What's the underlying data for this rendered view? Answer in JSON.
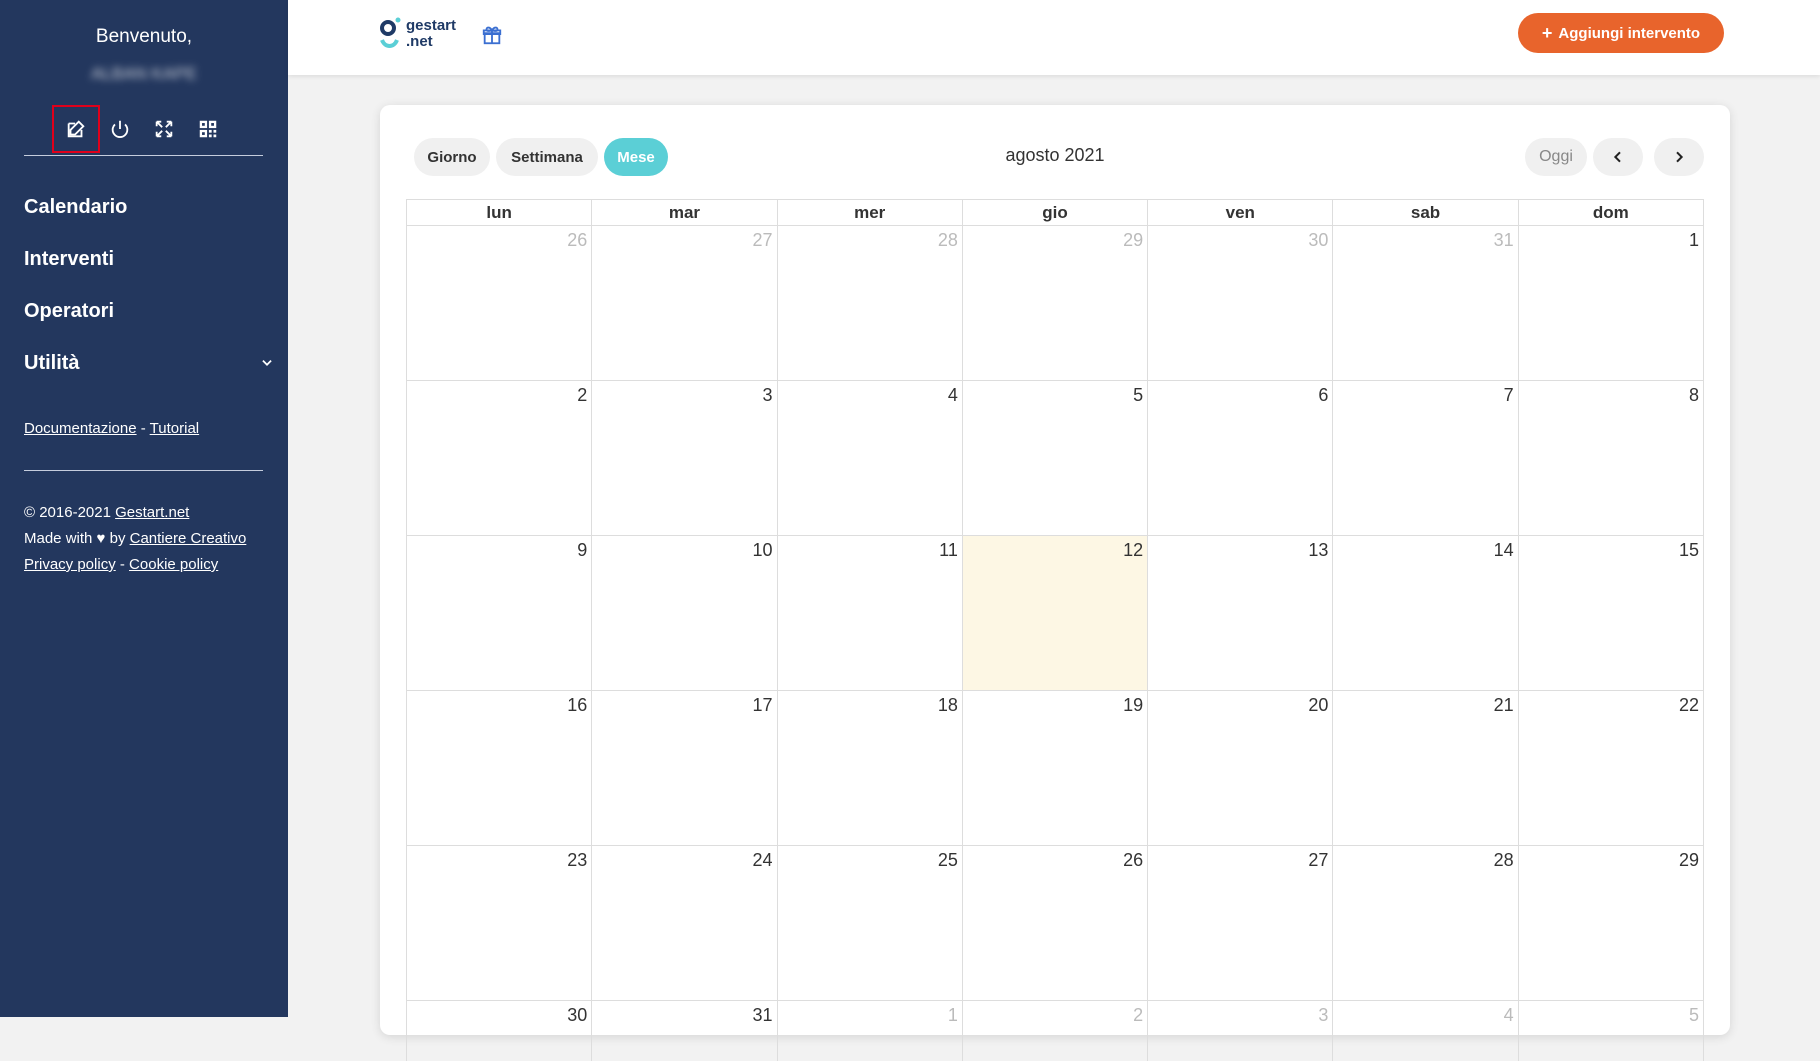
{
  "sidebar": {
    "welcome": "Benvenuto,",
    "username": "ALBAN KAPE",
    "nav": [
      {
        "label": "Calendario"
      },
      {
        "label": "Interventi"
      },
      {
        "label": "Operatori"
      },
      {
        "label": "Utilità"
      }
    ],
    "links": {
      "doc": "Documentazione",
      "sep": "-",
      "tutorial": "Tutorial"
    },
    "footer": {
      "copyright": "© 2016-2021",
      "company_link": "Gestart.net",
      "made_with": "Made with ♥ by",
      "creator_link": "Cantiere Creativo",
      "privacy": "Privacy policy",
      "sep": "-",
      "cookie": "Cookie policy"
    }
  },
  "topbar": {
    "logo_line1": "gestart",
    "logo_line2": ".net",
    "add_button": "Aggiungi intervento"
  },
  "calendar": {
    "views": {
      "day": "Giorno",
      "week": "Settimana",
      "month": "Mese"
    },
    "title": "agosto 2021",
    "today_button": "Oggi",
    "weekdays": [
      "lun",
      "mar",
      "mer",
      "gio",
      "ven",
      "sab",
      "dom"
    ],
    "weeks": [
      [
        {
          "d": "26",
          "other": true
        },
        {
          "d": "27",
          "other": true
        },
        {
          "d": "28",
          "other": true
        },
        {
          "d": "29",
          "other": true
        },
        {
          "d": "30",
          "other": true
        },
        {
          "d": "31",
          "other": true
        },
        {
          "d": "1"
        }
      ],
      [
        {
          "d": "2"
        },
        {
          "d": "3"
        },
        {
          "d": "4"
        },
        {
          "d": "5"
        },
        {
          "d": "6"
        },
        {
          "d": "7"
        },
        {
          "d": "8"
        }
      ],
      [
        {
          "d": "9"
        },
        {
          "d": "10"
        },
        {
          "d": "11"
        },
        {
          "d": "12",
          "today": true
        },
        {
          "d": "13"
        },
        {
          "d": "14"
        },
        {
          "d": "15"
        }
      ],
      [
        {
          "d": "16"
        },
        {
          "d": "17"
        },
        {
          "d": "18"
        },
        {
          "d": "19"
        },
        {
          "d": "20"
        },
        {
          "d": "21"
        },
        {
          "d": "22"
        }
      ],
      [
        {
          "d": "23"
        },
        {
          "d": "24"
        },
        {
          "d": "25"
        },
        {
          "d": "26"
        },
        {
          "d": "27"
        },
        {
          "d": "28"
        },
        {
          "d": "29"
        }
      ],
      [
        {
          "d": "30"
        },
        {
          "d": "31"
        },
        {
          "d": "1",
          "other": true
        },
        {
          "d": "2",
          "other": true
        },
        {
          "d": "3",
          "other": true
        },
        {
          "d": "4",
          "other": true
        },
        {
          "d": "5",
          "other": true
        }
      ]
    ]
  },
  "colors": {
    "sidebar_bg": "#23375e",
    "accent_orange": "#e8642c",
    "accent_teal": "#5bcfd6",
    "today_bg": "#fdf7e4"
  }
}
